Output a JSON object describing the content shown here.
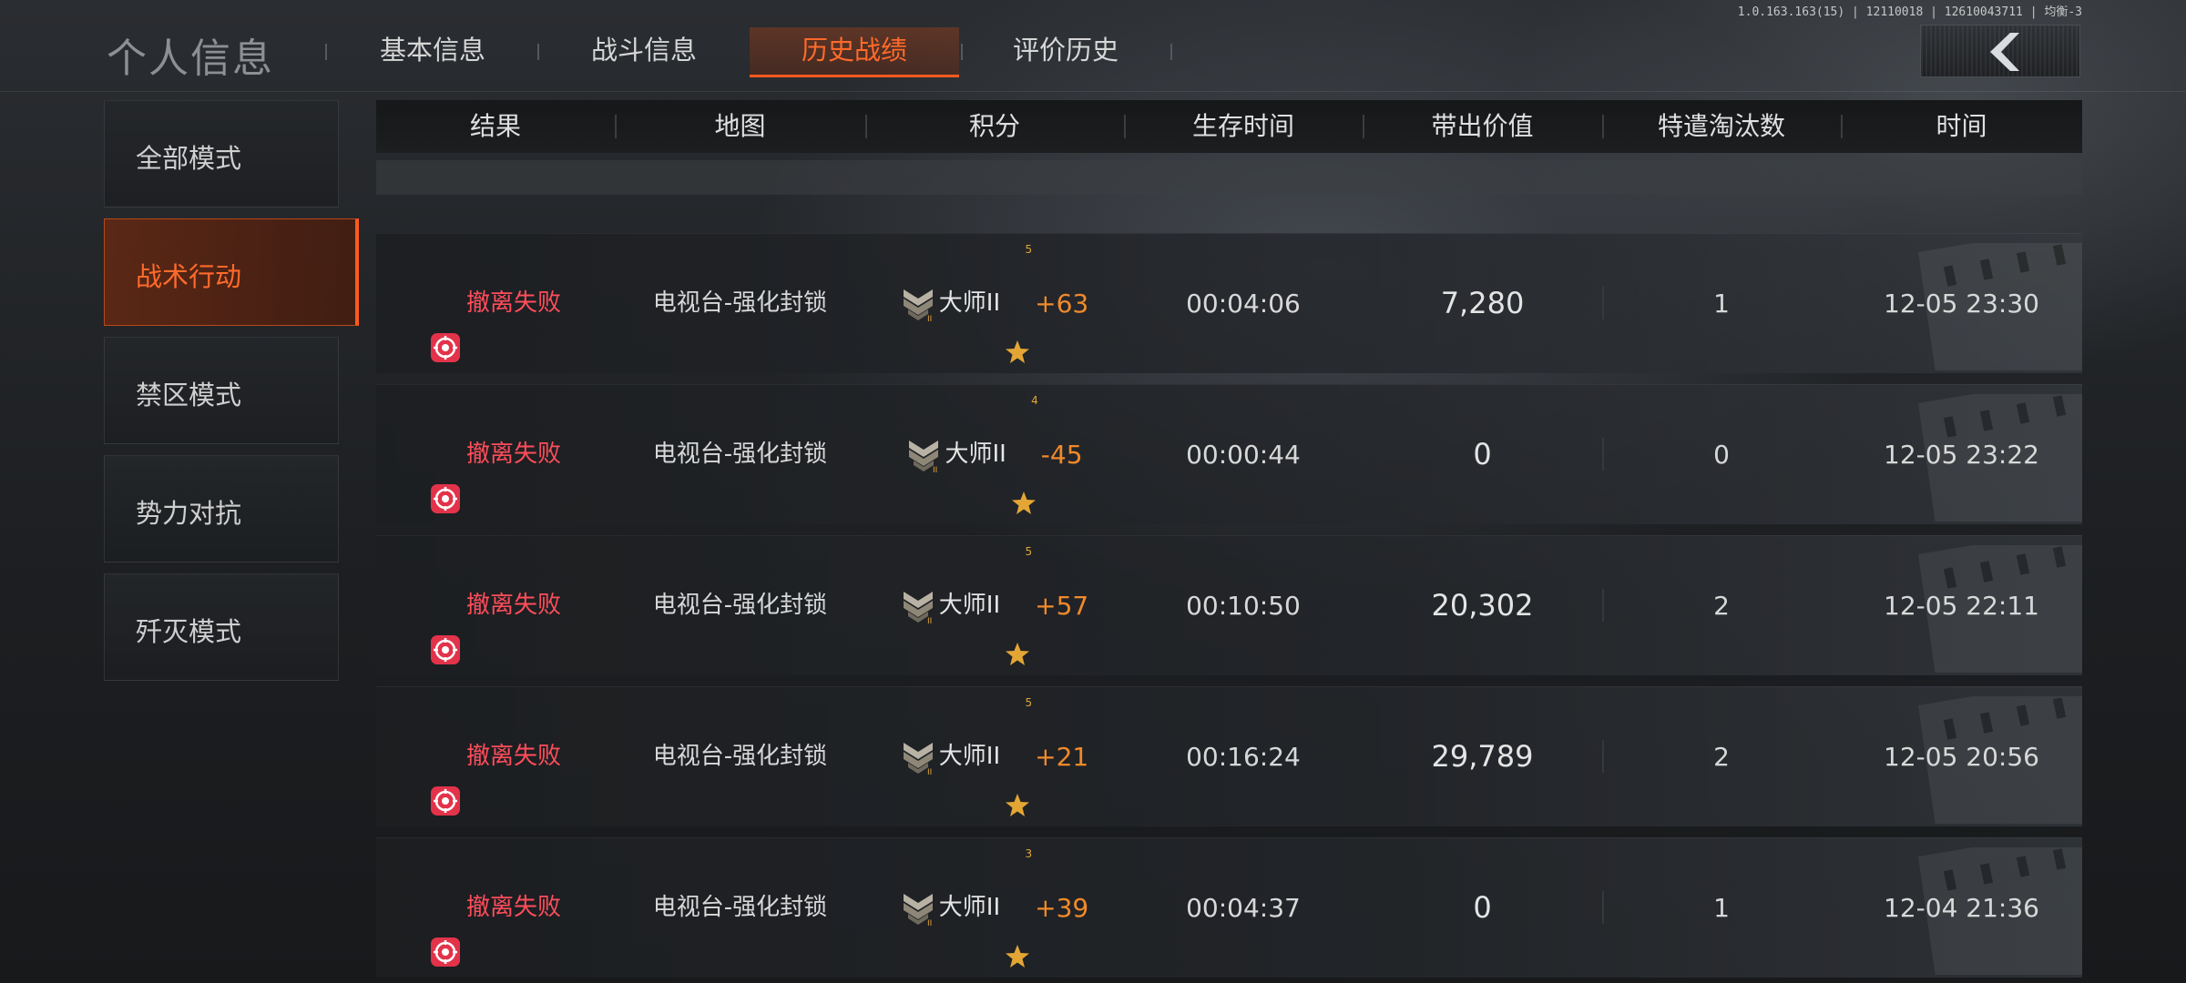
{
  "app": {
    "title": "个人信息",
    "version": "1.0.163.163(15) | 12110018 | 12610043711 | 均衡-3"
  },
  "tabs": [
    {
      "label": "基本信息",
      "active": false
    },
    {
      "label": "战斗信息",
      "active": false
    },
    {
      "label": "历史战绩",
      "active": true
    },
    {
      "label": "评价历史",
      "active": false
    }
  ],
  "back_button": {
    "icon": "chevron-left-icon"
  },
  "sidebar": {
    "items": [
      {
        "label": "全部模式",
        "active": false
      },
      {
        "label": "战术行动",
        "active": true
      },
      {
        "label": "禁区模式",
        "active": false
      },
      {
        "label": "势力对抗",
        "active": false
      },
      {
        "label": "歼灭模式",
        "active": false
      }
    ]
  },
  "table": {
    "columns": [
      "结果",
      "地图",
      "积分",
      "生存时间",
      "带出价值",
      "特遣淘汰数",
      "时间"
    ],
    "rows": [
      {
        "result": "撤离失败",
        "map": "电视台-强化封锁",
        "rank": "大师II",
        "stars": "5",
        "score": "+63",
        "survival": "00:04:06",
        "value": "7,280",
        "eliminations": "1",
        "time": "12-05 23:30"
      },
      {
        "result": "撤离失败",
        "map": "电视台-强化封锁",
        "rank": "大师II",
        "stars": "4",
        "score": "-45",
        "survival": "00:00:44",
        "value": "0",
        "eliminations": "0",
        "time": "12-05 23:22"
      },
      {
        "result": "撤离失败",
        "map": "电视台-强化封锁",
        "rank": "大师II",
        "stars": "5",
        "score": "+57",
        "survival": "00:10:50",
        "value": "20,302",
        "eliminations": "2",
        "time": "12-05 22:11"
      },
      {
        "result": "撤离失败",
        "map": "电视台-强化封锁",
        "rank": "大师II",
        "stars": "5",
        "score": "+21",
        "survival": "00:16:24",
        "value": "29,789",
        "eliminations": "2",
        "time": "12-05 20:56"
      },
      {
        "result": "撤离失败",
        "map": "电视台-强化封锁",
        "rank": "大师II",
        "stars": "3",
        "score": "+39",
        "survival": "00:04:37",
        "value": "0",
        "eliminations": "1",
        "time": "12-04 21:36"
      }
    ]
  },
  "colors": {
    "accent": "#ff6a2b",
    "fail": "#ff4d5b",
    "score": "#f08a2a",
    "star": "#e3a635"
  }
}
